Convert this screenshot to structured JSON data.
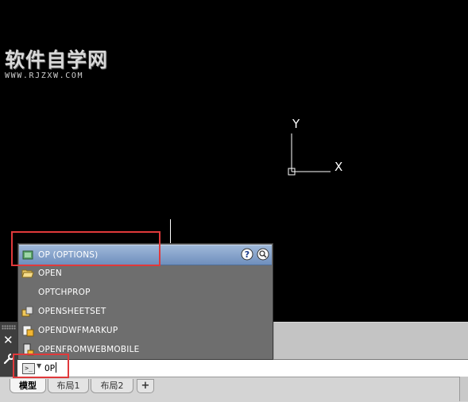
{
  "watermark": {
    "title": "软件自学网",
    "url": "WWW.RJZXW.COM"
  },
  "ucs": {
    "x_label": "X",
    "y_label": "Y"
  },
  "autocomplete": {
    "items": [
      {
        "label": "OP (OPTIONS)",
        "icon": "options-icon",
        "selected": true
      },
      {
        "label": "OPEN",
        "icon": "folder-open-icon"
      },
      {
        "label": "OPTCHPROP",
        "icon": ""
      },
      {
        "label": "OPENSHEETSET",
        "icon": "sheetset-icon"
      },
      {
        "label": "OPENDWFMARKUP",
        "icon": "dwf-markup-icon"
      },
      {
        "label": "OPENFROMWEBMOBILE",
        "icon": "web-mobile-icon"
      }
    ],
    "help_icon": "help-icon",
    "web_icon": "internet-search-icon"
  },
  "command_line": {
    "value": "OP",
    "prompt_icon": "command-prompt-icon"
  },
  "layout_tabs": [
    {
      "label": "模型",
      "active": true
    },
    {
      "label": "布局1",
      "active": false
    },
    {
      "label": "布局2",
      "active": false
    }
  ],
  "add_tab_label": "+",
  "colors": {
    "highlight_box": "#e0393b",
    "selected_row": "#7d9bc6",
    "popup_bg": "#6e6e6e"
  }
}
